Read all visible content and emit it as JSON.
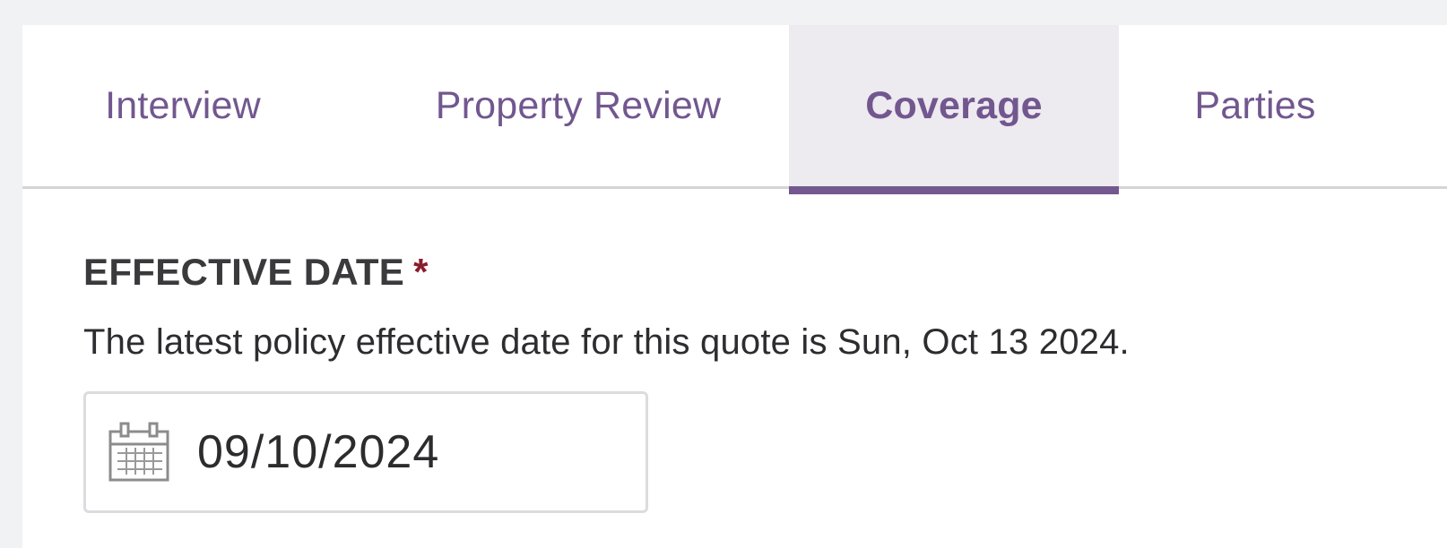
{
  "tabs": [
    {
      "label": "Interview",
      "active": false
    },
    {
      "label": "Property Review",
      "active": false
    },
    {
      "label": "Coverage",
      "active": true
    },
    {
      "label": "Parties",
      "active": false
    }
  ],
  "effective_date": {
    "label": "EFFECTIVE DATE",
    "required_marker": "*",
    "help_text": "The latest policy effective date for this quote is Sun, Oct 13 2024.",
    "value": "09/10/2024",
    "icon": "calendar-icon"
  },
  "colors": {
    "accent": "#73588f",
    "active_tab_bg": "#edeaf0",
    "required": "#8a1c2b",
    "background": "#f1f2f4"
  }
}
